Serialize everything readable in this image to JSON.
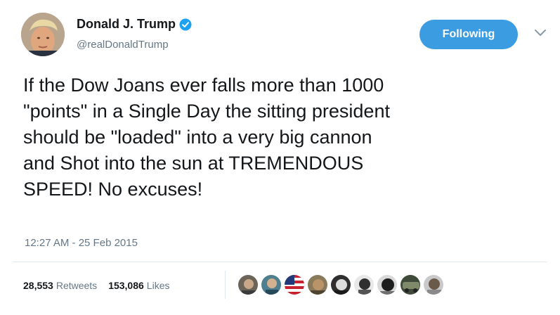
{
  "user": {
    "display_name": "Donald J. Trump",
    "handle": "@realDonaldTrump",
    "avatar_icon": "profile-photo",
    "verified_icon": "verified-badge-icon",
    "verified_color": "#1da1f2"
  },
  "follow_button": {
    "label": "Following",
    "color": "#3b9ce2"
  },
  "menu_icon": "chevron-down-icon",
  "tweet": {
    "text": "If the Dow Joans ever falls more than 1000\n\"points\" in a Single Day the sitting president\nshould be \"loaded\" into a very big cannon\nand Shot into the sun at TREMENDOUS\nSPEED! No excuses!",
    "timestamp": "12:27 AM - 25 Feb 2015"
  },
  "stats": {
    "retweets_count": "28,553",
    "retweets_label": "Retweets",
    "likes_count": "153,086",
    "likes_label": "Likes"
  },
  "likers": [
    "liker-avatar-1",
    "liker-avatar-2",
    "liker-avatar-3",
    "liker-avatar-4",
    "liker-avatar-5",
    "liker-avatar-6",
    "liker-avatar-7",
    "liker-avatar-8",
    "liker-avatar-9"
  ]
}
